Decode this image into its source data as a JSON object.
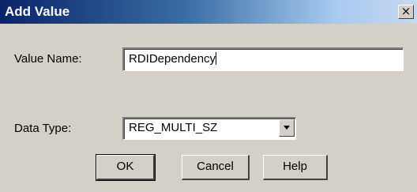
{
  "window": {
    "title": "Add Value",
    "close_glyph": "×"
  },
  "form": {
    "value_name_label": "Value Name:",
    "value_name_value": "RDIDependency",
    "data_type_label": "Data Type:",
    "data_type_selected": "REG_MULTI_SZ"
  },
  "buttons": {
    "ok": "OK",
    "cancel": "Cancel",
    "help": "Help"
  }
}
